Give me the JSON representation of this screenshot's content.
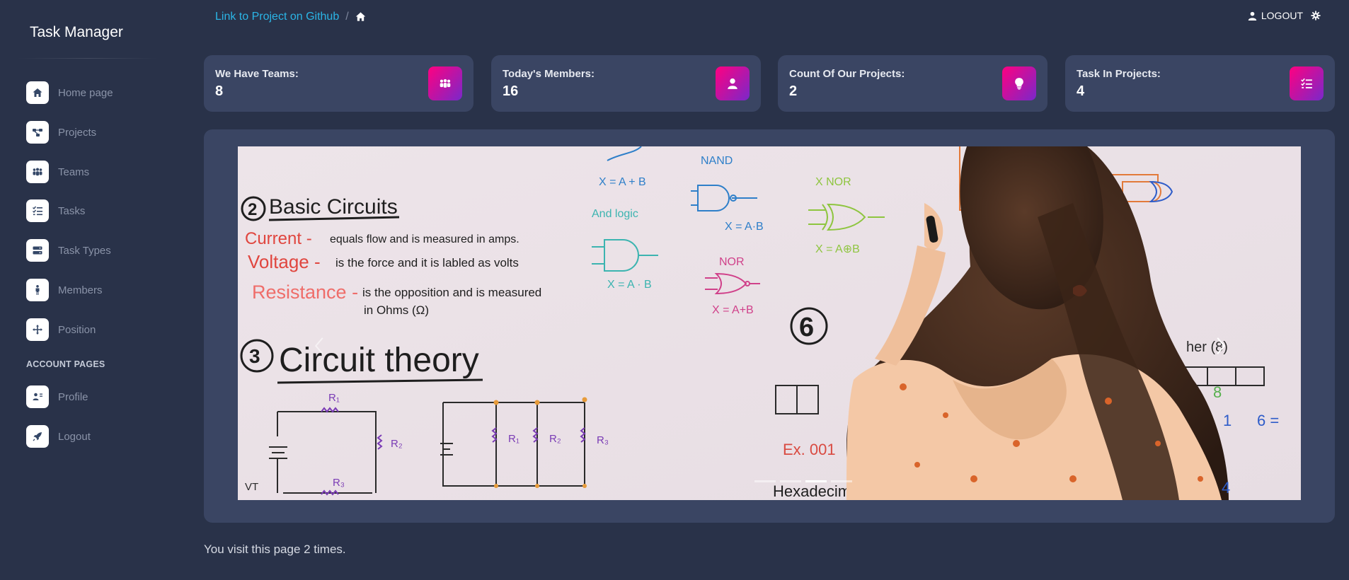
{
  "app": {
    "title": "Task Manager"
  },
  "sidebar": {
    "items": [
      {
        "label": "Home page",
        "icon": "home-icon"
      },
      {
        "label": "Projects",
        "icon": "projects-icon"
      },
      {
        "label": "Teams",
        "icon": "teams-icon"
      },
      {
        "label": "Tasks",
        "icon": "tasks-icon"
      },
      {
        "label": "Task Types",
        "icon": "task-types-icon"
      },
      {
        "label": "Members",
        "icon": "members-icon"
      },
      {
        "label": "Position",
        "icon": "position-icon"
      }
    ],
    "section_title": "ACCOUNT PAGES",
    "account_items": [
      {
        "label": "Profile",
        "icon": "profile-icon"
      },
      {
        "label": "Logout",
        "icon": "rocket-icon"
      }
    ]
  },
  "header": {
    "breadcrumb_link": "Link to Project on Github",
    "breadcrumb_separator": "/",
    "logout_label": "LOGOUT"
  },
  "stats": [
    {
      "title": "We Have Teams:",
      "value": "8",
      "icon": "teams-icon"
    },
    {
      "title": "Today's Members:",
      "value": "16",
      "icon": "user-icon"
    },
    {
      "title": "Count Of Our Projects:",
      "value": "2",
      "icon": "lightbulb-icon"
    },
    {
      "title": "Task In Projects:",
      "value": "4",
      "icon": "tasks-icon"
    }
  ],
  "carousel": {
    "active_index": 2,
    "slide_count": 4,
    "whiteboard": {
      "heading_basic": "Basic Circuits",
      "num_2": "2",
      "num_3": "3",
      "num_6": "6",
      "current": "Current -",
      "current_desc": "equals flow and is measured in amps.",
      "voltage": "Voltage -",
      "voltage_desc": "is the force and it is labled as volts",
      "resistance": "Resistance -",
      "resistance_desc_1": "is the opposition and is measured",
      "resistance_desc_2": "in Ohms (Ω)",
      "heading_theory": "Circuit theory",
      "nand": "NAND",
      "nor": "NOR",
      "xnor": "X NOR",
      "and_logic": "And logic",
      "eq_and": "X = A · B",
      "eq_nand": "X = A·B",
      "eq_nor": "X = A+B",
      "eq_xnor": "X = A⊕B",
      "eq_top": "X = A + B",
      "hexadecimal": "Hexadecimal",
      "example": "Ex. 001",
      "r1": "R₁",
      "r2": "R₂",
      "r3": "R₃",
      "vt": "VT"
    }
  },
  "footer": {
    "visit_text": "You visit this page 2 times."
  },
  "colors": {
    "background": "#293249",
    "card": "#3a4563",
    "accent_link": "#2bb5e6",
    "icon_gradient_start": "#7928ca",
    "icon_gradient_end": "#ff0080"
  }
}
